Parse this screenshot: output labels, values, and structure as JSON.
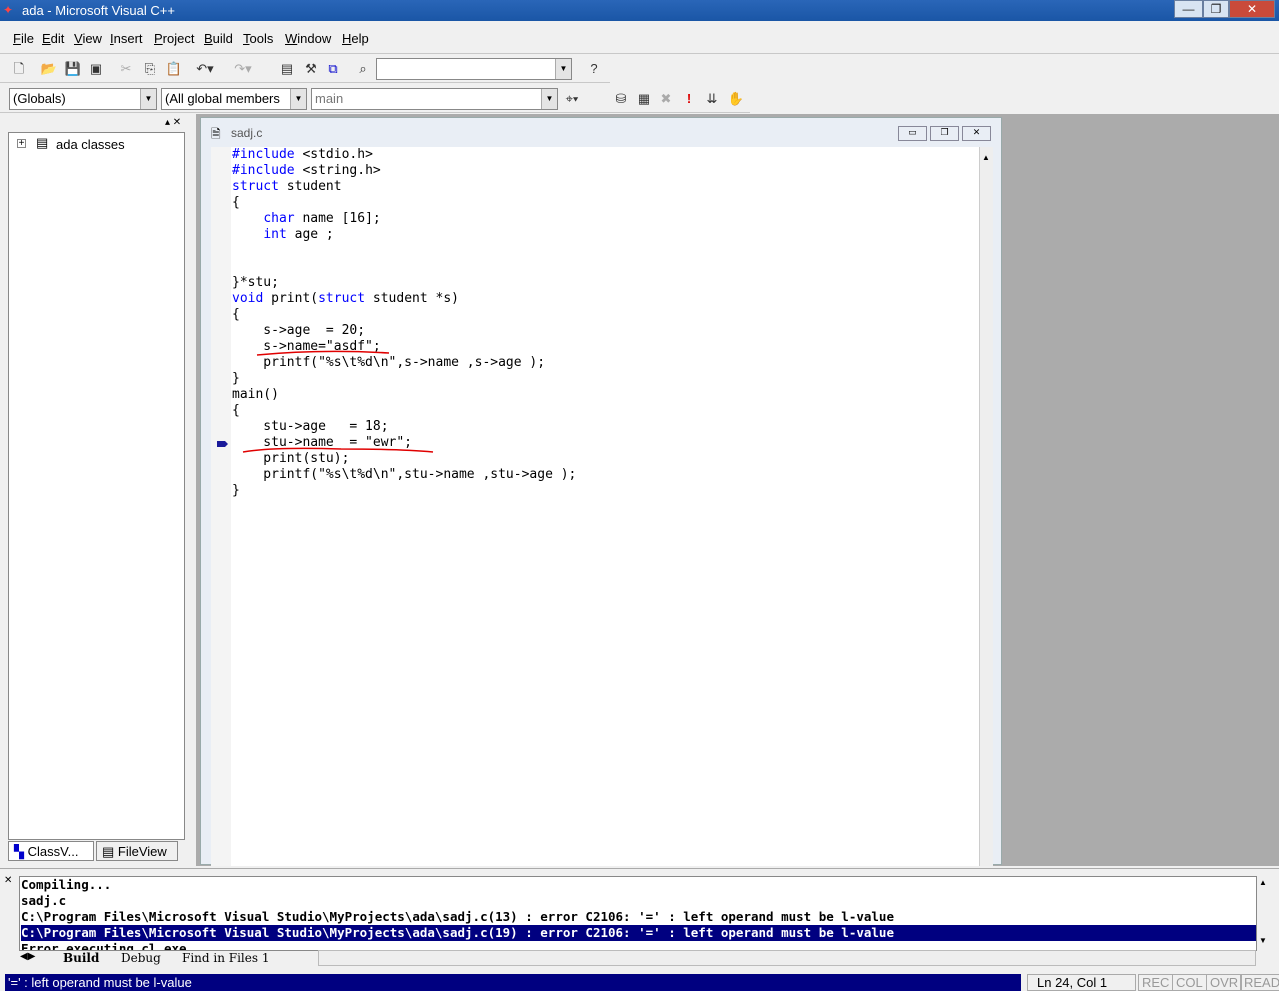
{
  "window": {
    "title": "ada - Microsoft Visual C++",
    "minimize": "—",
    "maximize": "❐",
    "close": "✕"
  },
  "menu": [
    "File",
    "Edit",
    "View",
    "Insert",
    "Project",
    "Build",
    "Tools",
    "Window",
    "Help"
  ],
  "toolbar": {
    "find_combo_value": "",
    "class_combo": "(Globals)",
    "members_combo": "(All global members",
    "function_combo": "main"
  },
  "workspace": {
    "tree_root": "ada classes",
    "tabs": [
      "ClassV...",
      "FileView"
    ]
  },
  "editor": {
    "filename": "sadj.c",
    "lines": [
      [
        [
          "#include",
          "kw"
        ],
        [
          " <stdio.h>",
          ""
        ]
      ],
      [
        [
          "#include",
          "kw"
        ],
        [
          " <string.h>",
          ""
        ]
      ],
      [
        [
          "struct",
          "kw"
        ],
        [
          " student",
          ""
        ]
      ],
      [
        [
          "{",
          ""
        ]
      ],
      [
        [
          "    ",
          ""
        ],
        [
          "char",
          "kw"
        ],
        [
          " name [16];",
          ""
        ]
      ],
      [
        [
          "    ",
          ""
        ],
        [
          "int",
          "kw"
        ],
        [
          " age ;",
          ""
        ]
      ],
      [],
      [],
      [
        [
          "}*stu;",
          ""
        ]
      ],
      [
        [
          "void",
          "kw"
        ],
        [
          " print(",
          ""
        ],
        [
          "struct",
          "kw"
        ],
        [
          " student *s)",
          ""
        ]
      ],
      [
        [
          "{",
          ""
        ]
      ],
      [
        [
          "    s->age  = 20;",
          ""
        ]
      ],
      [
        [
          "    s->name=\"asdf\";",
          ""
        ]
      ],
      [
        [
          "    printf(\"%s\\t%d\\n\",s->name ,s->age );",
          ""
        ]
      ],
      [
        [
          "}",
          ""
        ]
      ],
      [
        [
          "main()",
          ""
        ]
      ],
      [
        [
          "{",
          ""
        ]
      ],
      [
        [
          "    stu->age   = 18;",
          ""
        ]
      ],
      [
        [
          "    stu->name  = \"ewr\";",
          ""
        ]
      ],
      [
        [
          "    print(stu);",
          ""
        ]
      ],
      [
        [
          "    printf(\"%s\\t%d\\n\",stu->name ,stu->age );",
          ""
        ]
      ],
      [
        [
          "}",
          ""
        ]
      ]
    ],
    "current_line_marker": 19,
    "annotation_color": "#e00000"
  },
  "output": {
    "lines": [
      "Compiling...",
      "sadj.c",
      "C:\\Program Files\\Microsoft Visual Studio\\MyProjects\\ada\\sadj.c(13) : error C2106: '=' : left operand must be l-value",
      "C:\\Program Files\\Microsoft Visual Studio\\MyProjects\\ada\\sadj.c(19) : error C2106: '=' : left operand must be l-value",
      "Error executing cl.exe."
    ],
    "selected": 3,
    "tabs": [
      "Build",
      "Debug",
      "Find in Files 1"
    ]
  },
  "status": {
    "message": "'=' : left operand must be l-value",
    "position": "Ln 24, Col 1",
    "indicators": [
      "REC",
      "COL",
      "OVR",
      "READ"
    ]
  }
}
